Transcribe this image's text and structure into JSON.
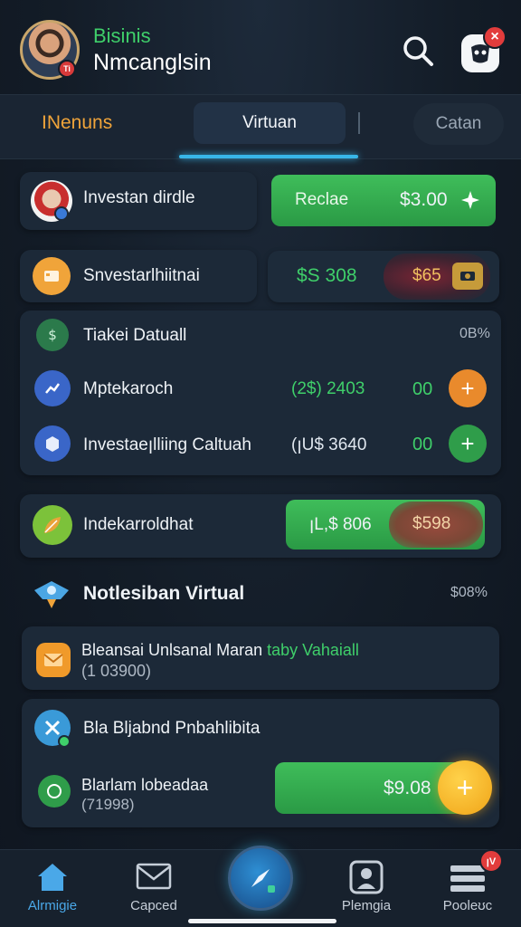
{
  "header": {
    "brand_top": "Bisinis",
    "brand_bottom": "Nmcanglsin",
    "avatar_badge": "Ti",
    "app_badge": "×"
  },
  "tabs": [
    {
      "label": "INenuns",
      "active": false
    },
    {
      "label": "Virtuan",
      "active": true
    },
    {
      "label": "Catan",
      "active": false
    }
  ],
  "card1": {
    "label": "Investan dirdle",
    "pill_left": "Reclae",
    "pill_value": "$3.00",
    "pill_icon": "sparkle-icon"
  },
  "card2": {
    "label": "Snvestarlhiitnai",
    "value": "$S 308",
    "value_red": "$65"
  },
  "list": {
    "header": {
      "label": "Tiakei Datuall",
      "value": "0B%"
    },
    "rows": [
      {
        "label": "Mptekaroch",
        "amount": "(2$) 2403",
        "right": "00",
        "btn": "+",
        "btn_color": "#e98a2c"
      },
      {
        "label": "Investaeꞁlliing Caltuah",
        "amount": "(ꞁU$ 3640",
        "right": "00",
        "btn": "+",
        "btn_color": "#2f9d4a"
      }
    ]
  },
  "card3": {
    "label": "Indekarroldhat",
    "pill_value": "ꞁL,$ 806",
    "pill_red": "$598"
  },
  "section": {
    "title": "Notlesiban Virtual",
    "value": "$08%"
  },
  "card4": {
    "label": "Bleansai Unlsanal Maran",
    "label_green": "taby Vahaiall",
    "sub": "(1 03900)"
  },
  "card5": {
    "title": "Bla Bljabnd Pnbahlibita",
    "row_label": "Blarlam lobeadaa",
    "row_sub": "(71998)",
    "pill_value": "$9.08",
    "btn": "+"
  },
  "nav": [
    {
      "label": "Alrmigie",
      "icon": "home-icon",
      "active": true
    },
    {
      "label": "Capced",
      "icon": "mail-icon",
      "active": false
    },
    {
      "label": "",
      "icon": "compass-icon",
      "active": false
    },
    {
      "label": "Plemgia",
      "icon": "profile-icon",
      "active": false
    },
    {
      "label": "Pooleʊc",
      "icon": "menu-icon",
      "active": false
    }
  ],
  "nav_badge": "ꞁV",
  "colors": {
    "green": "#3fcf6a",
    "orange": "#f0a43a",
    "accent": "#38b6e8",
    "red": "#e23c3c"
  }
}
